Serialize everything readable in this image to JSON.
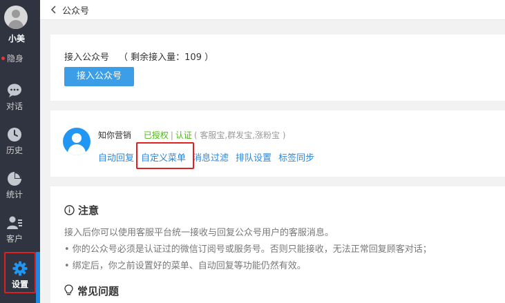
{
  "sidebar": {
    "user_name": "小美",
    "status": "隐身",
    "items": [
      {
        "label": "对话",
        "icon": "chat-icon"
      },
      {
        "label": "历史",
        "icon": "clock-icon"
      },
      {
        "label": "统计",
        "icon": "pie-chart-icon"
      },
      {
        "label": "客户",
        "icon": "contacts-icon"
      },
      {
        "label": "设置",
        "icon": "gear-icon",
        "active": true
      }
    ]
  },
  "header": {
    "title": "公众号"
  },
  "access": {
    "title": "接入公众号",
    "remaining": "（ 剩余接入量：109 ）",
    "button_label": "接入公众号"
  },
  "account": {
    "name": "知你营销",
    "authorized": "已授权",
    "separator": "|",
    "verified": "认证",
    "services": "( 客服宝,群发宝,涨粉宝 )",
    "links": [
      "自动回复",
      "自定义菜单",
      "消息过滤",
      "排队设置",
      "标签同步"
    ]
  },
  "notice": {
    "title": "注意",
    "lines": [
      "接入后你可以使用客服平台统一接收与回复公众号用户的客服消息。",
      "• 你的公众号必须是认证过的微信订阅号或服务号。否则只能接收，无法正常回复顾客对话；",
      "• 绑定后，你之前设置好的菜单、自动回复等功能仍然有效。"
    ]
  },
  "faq": {
    "title": "常见问题"
  },
  "colors": {
    "sidebar_bg": "#2f3440",
    "accent": "#3d9ee8",
    "link": "#2f86d8",
    "success": "#52b41d",
    "highlight": "#e02020"
  }
}
